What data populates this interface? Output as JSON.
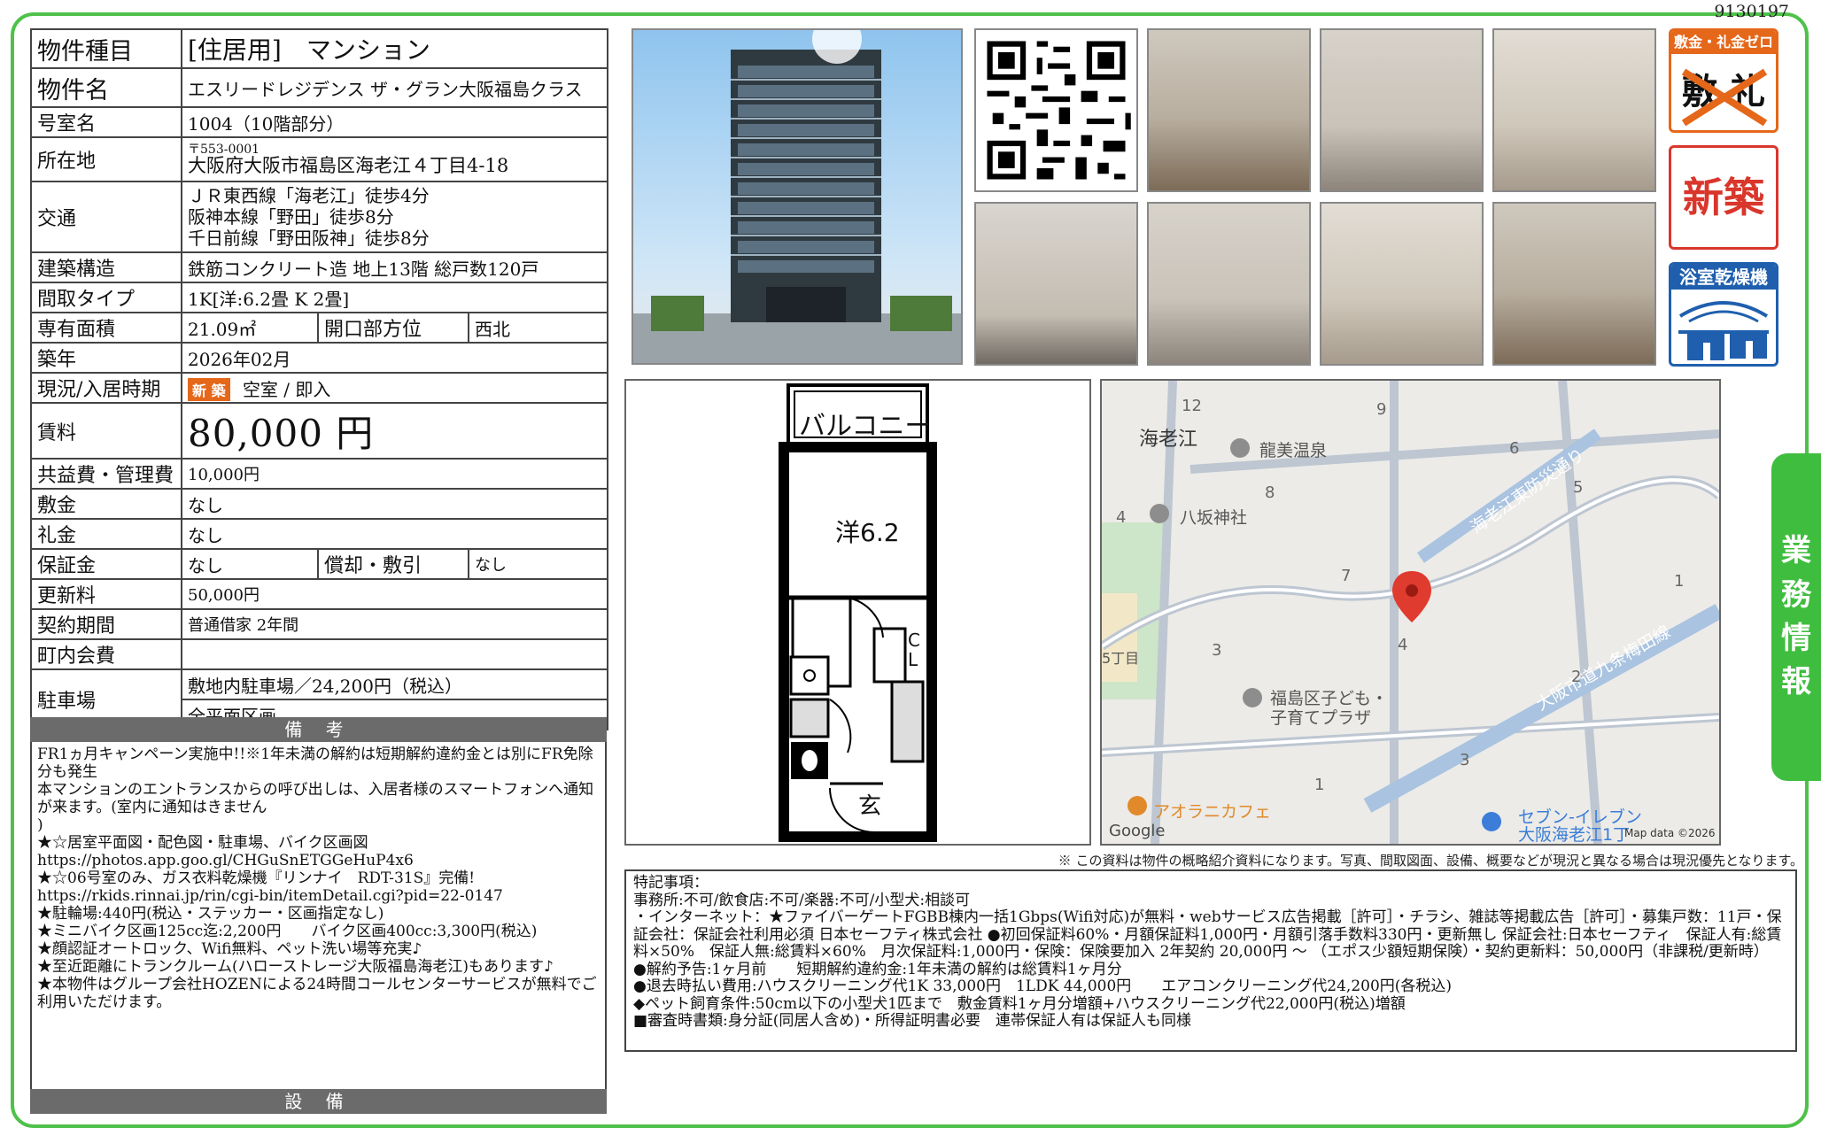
{
  "doc_id": "9130197",
  "side_tab": [
    "業",
    "務",
    "情",
    "報"
  ],
  "table": {
    "type_label": "物件種目",
    "type_value": "[住居用]　マンション",
    "name_label": "物件名",
    "name_value": "エスリードレジデンス ザ・グラン大阪福島クラス",
    "room_label": "号室名",
    "room_value": "1004（10階部分）",
    "address_label": "所在地",
    "address_zip": "〒553-0001",
    "address_value": "大阪府大阪市福島区海老江４丁目4-18",
    "transport_label": "交通",
    "transport_lines": [
      "ＪＲ東西線「海老江」徒歩4分",
      "阪神本線「野田」徒歩8分",
      "千日前線「野田阪神」徒歩8分"
    ],
    "structure_label": "建築構造",
    "structure_value": "鉄筋コンクリート造 地上13階 総戸数120戸",
    "layout_label": "間取タイプ",
    "layout_value": "1K[洋:6.2畳 K 2畳]",
    "area_label": "専有面積",
    "area_value": "21.09㎡",
    "direction_label": "開口部方位",
    "direction_value": "西北",
    "built_label": "築年",
    "built_value": "2026年02月",
    "status_label": "現況/入居時期",
    "status_badge": "新 築",
    "status_value": "空室 / 即入",
    "rent_label": "賃料",
    "rent_value": "80,000 円",
    "fee_label": "共益費・管理費",
    "fee_value": "10,000円",
    "deposit_label": "敷金",
    "deposit_value": "なし",
    "keymoney_label": "礼金",
    "keymoney_value": "なし",
    "guarantee_label": "保証金",
    "guarantee_value": "なし",
    "amort_label": "償却・敷引",
    "amort_value": "なし",
    "renewal_label": "更新料",
    "renewal_value": "50,000円",
    "contract_label": "契約期間",
    "contract_value": "普通借家 2年間",
    "town_label": "町内会費",
    "town_value": "",
    "parking_label": "駐車場",
    "parking_value1": "敷地内駐車場／24,200円（税込）",
    "parking_value2": "全平面区画"
  },
  "remarks_head": "備 考",
  "remarks": [
    "FR1ヵ月キャンペーン実施中!!※1年未満の解約は短期解約違約金とは別にFR免除分も発生",
    "",
    "本マンションのエントランスからの呼び出しは、入居者様のスマートフォンへ通知が来ます。(室内に通知はきません",
    ")",
    "★☆居室平面図・配色図・駐車場、バイク区画図",
    "https://photos.app.goo.gl/CHGuSnETGGeHuP4x6",
    "",
    "★☆06号室のみ、ガス衣料乾燥機『リンナイ　RDT-31S』完備!",
    "https://rkids.rinnai.jp/rin/cgi-bin/itemDetail.cgi?pid=22-0147",
    "",
    "★駐輪場:440円(税込・ステッカー・区画指定なし)",
    "★ミニバイク区画125cc迄:2,200円　　バイク区画400cc:3,300円(税込)",
    "",
    "★顔認証オートロック、Wifi無料、ペット洗い場等充実♪",
    "★至近距離にトランクルーム(ハローストレージ大阪福島海老江)もあります♪",
    "★本物件はグループ会社HOZENによる24時間コールセンターサービスが無料でご利用いただけます。"
  ],
  "equipment_head": "設 備",
  "badges": {
    "zero": "敷金・礼金ゼロ",
    "zero_chars": "敷 礼",
    "new": "新築",
    "bath": "浴室乾燥機"
  },
  "floorplan": {
    "balcony": "バルコニー",
    "room": "洋6.2",
    "cl": "CL",
    "entry": "玄"
  },
  "map": {
    "labels": [
      "海老江",
      "龍美温泉",
      "八坂神社",
      "海老江東防災通り",
      "福島区子ども・",
      "子育てプラザ",
      "大阪市道九条梅田線",
      "アオラニカフェ",
      "セブン-イレブン",
      "大阪海老江1丁",
      "5丁目",
      "Google",
      "Map data ©2026"
    ],
    "numbers": [
      "12",
      "9",
      "6",
      "5",
      "4",
      "8",
      "7",
      "1",
      "3",
      "4",
      "2",
      "3",
      "1"
    ]
  },
  "disclaimer": "※ この資料は物件の概略紹介資料になります。写真、間取図面、設備、概要などが現況と異なる場合は現況優先となります。",
  "special": [
    "特記事項：",
    "事務所:不可/飲食店:不可/楽器:不可/小型犬:相談可",
    "・インターネット：★ファイバーゲートFGBB棟内一括1Gbps(Wifi対応)が無料・webサービス広告掲載［許可］・チラシ、雑誌等掲載広告［許可］・募集戸数：11戸・保証会社：保証会社利用必須 日本セーフティ株式会社 ●初回保証料60%・月額保証料1,000円・月額引落手数料330円・更新無し 保証会社:日本セーフティ　保証人有:総賃料×50%　保証人無:総賃料×60%　月次保証料:1,000円・保険：保険要加入 2年契約 20,000円 ～ （エポス少額短期保険）・契約更新料：50,000円（非課税/更新時）",
    "●解約予告:1ヶ月前　　短期解約違約金:1年未満の解約は総賃料1ヶ月分",
    "●退去時払い費用:ハウスクリーニング代1K 33,000円　1LDK 44,000円　　エアコンクリーニング代24,200円(各税込)",
    "◆ペット飼育条件:50cm以下の小型犬1匹まで　敷金賃料1ヶ月分増額+ハウスクリーニング代22,000円(税込)増額",
    "■審査時書類:身分証(同居人含め)・所得証明書必要　連帯保証人有は保証人も同様"
  ],
  "colors": {
    "frame": "#4fc14a",
    "accent": "#e5671a",
    "header_gray": "#6b6b6b"
  }
}
